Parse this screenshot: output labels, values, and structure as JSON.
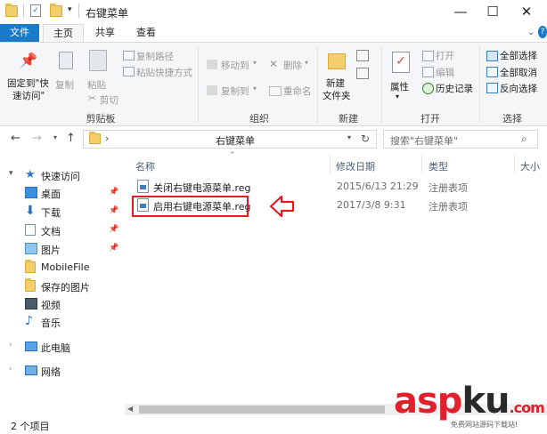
{
  "window": {
    "title": "右键菜单",
    "minimize": "—",
    "maximize": "☐",
    "close": "✕"
  },
  "tabs": [
    "文件",
    "主页",
    "共享",
    "查看"
  ],
  "ribbon": {
    "clipboard": {
      "pin_quick_access_line1": "固定到\"快",
      "pin_quick_access_line2": "速访问\"",
      "copy": "复制",
      "paste": "粘贴",
      "copy_path": "复制路径",
      "paste_shortcut": "粘贴快捷方式",
      "cut": "剪切",
      "label": "剪贴板"
    },
    "organize": {
      "move_to": "移动到",
      "copy_to": "复制到",
      "delete": "删除",
      "rename": "重命名",
      "label": "组织"
    },
    "new": {
      "new_folder_line1": "新建",
      "new_folder_line2": "文件夹",
      "label": "新建"
    },
    "open": {
      "properties": "属性",
      "open": "打开",
      "edit": "编辑",
      "history": "历史记录",
      "label": "打开"
    },
    "select": {
      "select_all": "全部选择",
      "select_none": "全部取消",
      "invert": "反向选择",
      "label": "选择"
    }
  },
  "address": {
    "path": "右键菜单",
    "search_placeholder": "搜索\"右键菜单\""
  },
  "nav": [
    {
      "label": "快速访问",
      "icon": "star-icon",
      "pinned": false
    },
    {
      "label": "桌面",
      "icon": "desktop-icon",
      "pinned": true
    },
    {
      "label": "下载",
      "icon": "download-icon",
      "pinned": true
    },
    {
      "label": "文档",
      "icon": "document-icon",
      "pinned": true
    },
    {
      "label": "图片",
      "icon": "picture-icon",
      "pinned": true
    },
    {
      "label": "MobileFile",
      "icon": "folder-icon",
      "pinned": false
    },
    {
      "label": "保存的图片",
      "icon": "folder-icon",
      "pinned": false
    },
    {
      "label": "视频",
      "icon": "video-icon",
      "pinned": false
    },
    {
      "label": "音乐",
      "icon": "music-icon",
      "pinned": false
    },
    {
      "label": "此电脑",
      "icon": "computer-icon",
      "pinned": false
    },
    {
      "label": "网络",
      "icon": "network-icon",
      "pinned": false
    }
  ],
  "columns": [
    "名称",
    "修改日期",
    "类型",
    "大小"
  ],
  "files": [
    {
      "name": "关闭右键电源菜单.reg",
      "date": "2015/6/13 21:29",
      "type": "注册表项"
    },
    {
      "name": "启用右键电源菜单.reg",
      "date": "2017/3/8 9:31",
      "type": "注册表项"
    }
  ],
  "status": {
    "count": "2 个项目"
  },
  "watermark": {
    "a": "asp",
    "b": "ku",
    "c": ".com",
    "sub": "免费网站源码下载站!"
  },
  "colors": {
    "accent": "#1979ca",
    "highlight": "#e21b22"
  }
}
